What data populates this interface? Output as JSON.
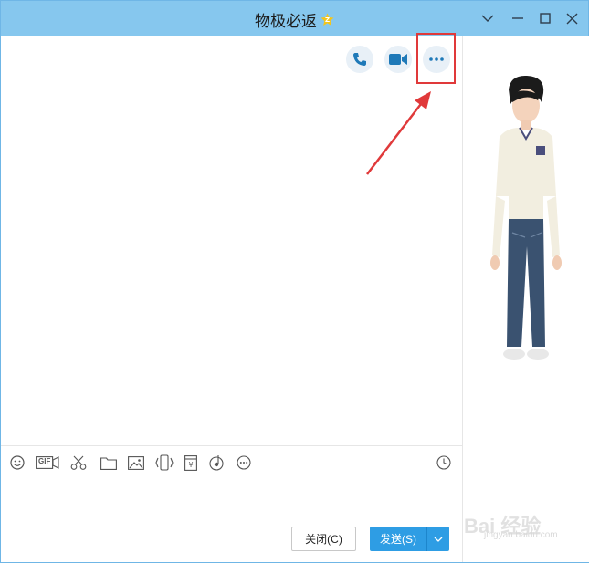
{
  "window": {
    "title": "物极必返",
    "controls": [
      "chevron-down-icon",
      "minimize-icon",
      "maximize-icon",
      "close-icon"
    ]
  },
  "colors": {
    "titlebar": "#86c7ee",
    "send_button": "#2e9de4",
    "highlight": "#e0393a"
  },
  "chat_header_tools": [
    {
      "name": "voice-call",
      "icon": "phone-icon"
    },
    {
      "name": "video-call",
      "icon": "video-camera-icon"
    },
    {
      "name": "more",
      "icon": "more-dots-icon"
    }
  ],
  "input_toolbar": [
    "emoji-icon",
    "gif-icon",
    "screenshot-scissors-icon",
    "folder-icon",
    "image-icon",
    "shake-icon",
    "red-packet-icon",
    "music-icon",
    "more-icon",
    "history-clock-icon"
  ],
  "input_toolbar_gif_label": "GIF",
  "buttons": {
    "close_label": "关闭(C)",
    "send_label": "发送(S)"
  },
  "watermark": {
    "brand": "Bai 经验",
    "url": "jingyan.baidu.com"
  }
}
